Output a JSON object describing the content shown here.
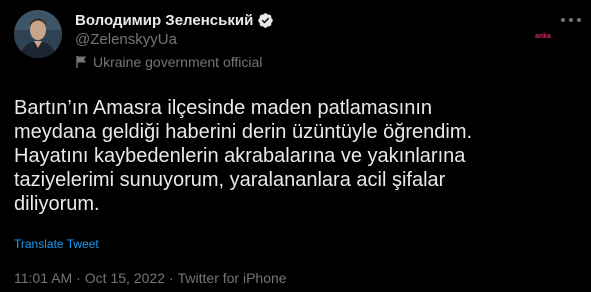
{
  "author": {
    "display_name": "Володимир Зеленський",
    "handle": "@ZelenskyyUa",
    "label": "Ukraine government official"
  },
  "watermark": "anka",
  "tweet": {
    "lines": [
      "Bartın’ın Amasra ilçesinde maden patlamasının",
      "meydana geldiği haberini derin üzüntüyle öğrendim.",
      "Hayatını kaybedenlerin akrabalarına ve yakınlarına",
      "taziyelerimi sunuyorum, yaralananlara acil şifalar",
      "diliyorum."
    ],
    "translate_label": "Translate Tweet"
  },
  "meta": {
    "time": "11:01 AM",
    "separator": "·",
    "date": "Oct 15, 2022",
    "source": "Twitter for iPhone"
  },
  "colors": {
    "background": "#000000",
    "text": "#e7e9ea",
    "muted": "#71767b",
    "link": "#1d9bf0",
    "watermark": "#e0245e"
  },
  "icons": {
    "verified": "verified-badge-icon",
    "label": "flag-icon",
    "more": "more-options-icon"
  }
}
